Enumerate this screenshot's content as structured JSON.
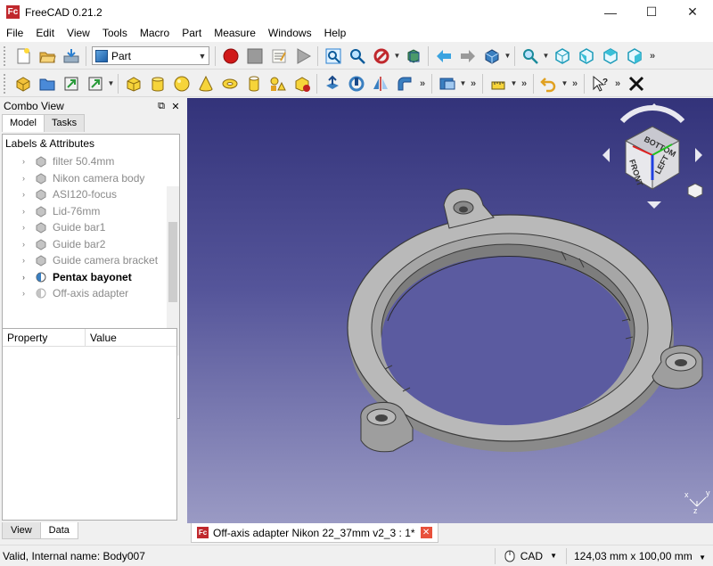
{
  "window": {
    "title": "FreeCAD 0.21.2",
    "logo_text": "Fc",
    "minimize": "—",
    "maximize": "☐",
    "close": "✕"
  },
  "menu": [
    "File",
    "Edit",
    "View",
    "Tools",
    "Macro",
    "Part",
    "Measure",
    "Windows",
    "Help"
  ],
  "toolbar": {
    "workbench": "Part",
    "overflow": "»"
  },
  "combo_view": {
    "title": "Combo View",
    "float_icon": "⧉",
    "close_icon": "✕",
    "tabs": [
      "Model",
      "Tasks"
    ],
    "active_tab": "Model",
    "tree_header": "Labels & Attributes",
    "items": [
      {
        "label": "filter 50.4mm",
        "bold": false
      },
      {
        "label": "Nikon camera body",
        "bold": false
      },
      {
        "label": "ASI120-focus",
        "bold": false
      },
      {
        "label": "Lid-76mm",
        "bold": false
      },
      {
        "label": "Guide bar1",
        "bold": false
      },
      {
        "label": "Guide bar2",
        "bold": false
      },
      {
        "label": "Guide camera bracket",
        "bold": false
      },
      {
        "label": "Pentax bayonet",
        "bold": true
      },
      {
        "label": "Off-axis adapter",
        "bold": false
      }
    ],
    "property_header": {
      "property": "Property",
      "value": "Value"
    },
    "bottom_tabs": [
      "View",
      "Data"
    ],
    "active_bottom_tab": "Data"
  },
  "navcube": {
    "faces": [
      "FRONT",
      "LEFT",
      "BOTTOM"
    ]
  },
  "axes": {
    "x": "x",
    "y": "y",
    "z": "z"
  },
  "document_tab": {
    "label": "Off-axis adapter Nikon 22_37mm v2_3 : 1*",
    "close": "✕"
  },
  "status": {
    "message": "Valid, Internal name: Body007",
    "nav_style": "CAD",
    "dimensions": "124,03 mm x 100,00 mm"
  },
  "colors": {
    "viewport_top": "#33337a",
    "viewport_bottom": "#9a9ac4",
    "model_gray": "#b9b9b9",
    "record_red": "#d01818"
  }
}
